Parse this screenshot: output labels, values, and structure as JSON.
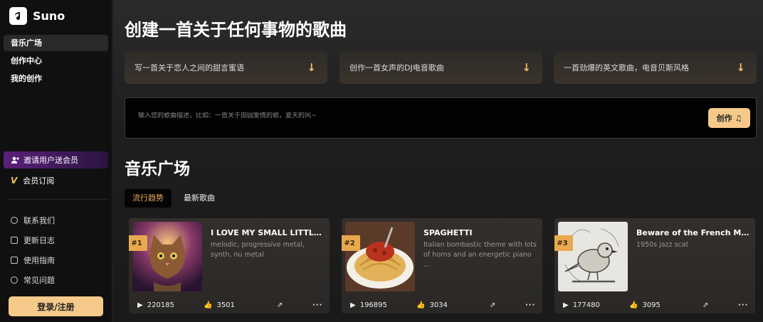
{
  "brand": {
    "name": "Suno",
    "logo_icon": "music-note-icon"
  },
  "sidebar": {
    "nav": [
      {
        "label": "音乐广场",
        "active": true
      },
      {
        "label": "创作中心",
        "active": false
      },
      {
        "label": "我的创作",
        "active": false
      }
    ],
    "invite_label": "邀请用户送会员",
    "member_label": "会员订阅",
    "links": [
      {
        "label": "联系我们",
        "icon": "headset-icon"
      },
      {
        "label": "更新日志",
        "icon": "calendar-icon"
      },
      {
        "label": "使用指南",
        "icon": "book-icon"
      },
      {
        "label": "常见问题",
        "icon": "question-icon"
      }
    ],
    "login_label": "登录/注册"
  },
  "hero": {
    "title": "创建一首关于任何事物的歌曲",
    "suggestions": [
      {
        "text": "写一首关于恋人之间的甜言蜜语"
      },
      {
        "text": "创作一首女声的DJ电音歌曲"
      },
      {
        "text": "一首劲爆的英文歌曲，电音贝斯风格"
      }
    ],
    "prompt_placeholder": "输入您的歌曲描述，比如：一首关于田园爱情的歌，夏天的风~",
    "create_label": "创作"
  },
  "plaza": {
    "title": "音乐广场",
    "tabs": [
      {
        "label": "流行趋势",
        "active": true
      },
      {
        "label": "最新歌曲",
        "active": false
      }
    ],
    "cards": [
      {
        "rank": "#1",
        "title": "I LOVE MY SMALL LITTLE ...",
        "tags": "melodic, progressive metal, synth, nu metal",
        "plays": "220185",
        "likes": "3501",
        "image": "cat-artwork"
      },
      {
        "rank": "#2",
        "title": "SPAGHETTI",
        "tags": "Italian bombastic theme with lots of horns and an energetic piano ...",
        "plays": "196895",
        "likes": "3034",
        "image": "spaghetti-artwork"
      },
      {
        "rank": "#3",
        "title": "Beware of the French Men ...",
        "tags": "1950s jazz scat",
        "plays": "177480",
        "likes": "3095",
        "image": "bird-sketch-artwork"
      }
    ]
  },
  "colors": {
    "accent": "#f4c98a",
    "rank_badge": "#e8a94e",
    "active_tab_text": "#f0a860",
    "invite_purple": "#5b1f7a"
  }
}
